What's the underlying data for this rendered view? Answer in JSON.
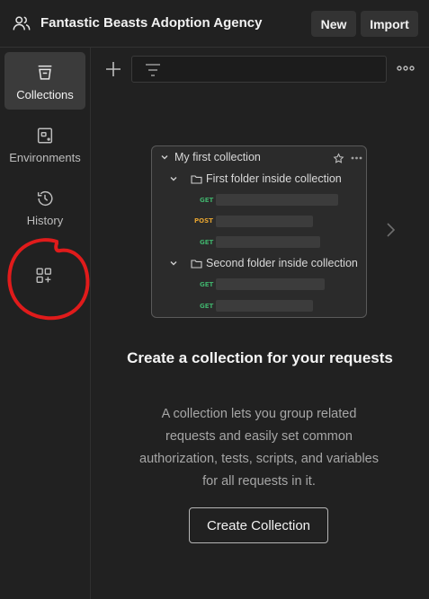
{
  "header": {
    "workspace_name": "Fantastic Beasts Adoption Agency",
    "workspace_icon": "team-icon",
    "new_label": "New",
    "import_label": "Import"
  },
  "sidebar": {
    "items": [
      {
        "label": "Collections",
        "icon": "collections-icon",
        "active": true
      },
      {
        "label": "Environments",
        "icon": "environments-icon",
        "active": false
      },
      {
        "label": "History",
        "icon": "history-icon",
        "active": false
      }
    ],
    "apps_icon": "add-apps-icon",
    "annotation_color": "#e01b1b"
  },
  "toolbar": {
    "add_icon": "plus-icon",
    "filter_icon": "filter-icon",
    "more_icon": "more-icon"
  },
  "illustration": {
    "collection_name": "My first collection",
    "folders": [
      {
        "name": "First folder inside collection",
        "requests": [
          "GET",
          "POST",
          "GET"
        ]
      },
      {
        "name": "Second folder inside collection",
        "requests": [
          "GET",
          "GET"
        ]
      }
    ]
  },
  "empty_state": {
    "title": "Create a collection for your requests",
    "description": "A collection lets you group related requests and easily set common authorization, tests, scripts, and variables for all requests in it.",
    "button_label": "Create Collection"
  },
  "colors": {
    "background": "#212121",
    "get_method": "#3fae6a",
    "post_method": "#e0a030"
  }
}
